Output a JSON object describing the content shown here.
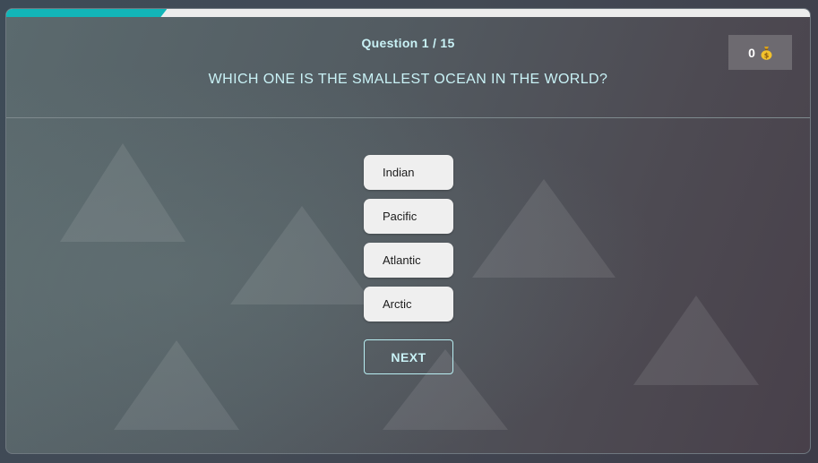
{
  "progress": {
    "fraction": 0.2
  },
  "header": {
    "counter": "Question 1 / 15",
    "question": "WHICH ONE IS THE SMALLEST OCEAN IN THE WORLD?"
  },
  "score": {
    "value": "0",
    "icon": "money-bag-icon"
  },
  "answers": [
    {
      "label": "Indian"
    },
    {
      "label": "Pacific"
    },
    {
      "label": "Atlantic"
    },
    {
      "label": "Arctic"
    }
  ],
  "controls": {
    "next_label": "NEXT"
  },
  "colors": {
    "accent": "#12b5b8",
    "text": "#c9f2f6",
    "answer_bg": "#efefef"
  }
}
